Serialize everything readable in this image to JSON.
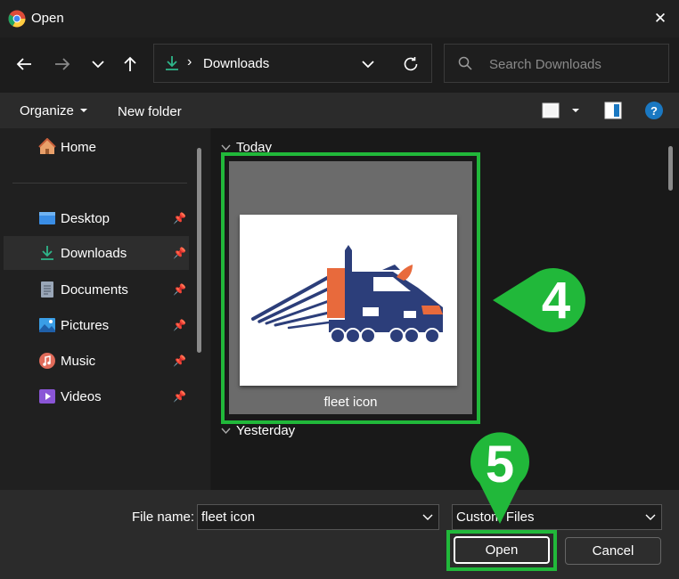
{
  "window": {
    "title": "Open",
    "close_label": "✕"
  },
  "nav": {
    "back_icon": "arrow-left-icon",
    "forward_icon": "arrow-right-icon",
    "recent_icon": "chevron-down-icon",
    "up_icon": "arrow-up-icon",
    "address": {
      "separator": "›",
      "location": "Downloads"
    },
    "search_placeholder": "Search Downloads"
  },
  "toolbar": {
    "organize_label": "Organize",
    "new_folder_label": "New folder",
    "help_label": "?"
  },
  "sidebar": {
    "home_label": "Home",
    "items": [
      {
        "label": "Desktop",
        "icon": "desktop-icon",
        "color": "#3a8ee6"
      },
      {
        "label": "Downloads",
        "icon": "download-icon",
        "color": "#2fb58a"
      },
      {
        "label": "Documents",
        "icon": "documents-icon",
        "color": "#9aa7b8"
      },
      {
        "label": "Pictures",
        "icon": "pictures-icon",
        "color": "#3a9ee6"
      },
      {
        "label": "Music",
        "icon": "music-icon",
        "color": "#e06b5a"
      },
      {
        "label": "Videos",
        "icon": "videos-icon",
        "color": "#8a55d6"
      }
    ]
  },
  "content": {
    "group_today": "Today",
    "group_yesterday": "Yesterday",
    "file": {
      "name": "fleet icon"
    }
  },
  "bottom": {
    "file_name_label": "File name:",
    "file_name_value": "fleet icon",
    "file_type_value": "Custom Files",
    "open_label": "Open",
    "cancel_label": "Cancel"
  },
  "annotations": {
    "step4": "4",
    "step5": "5",
    "highlight_color": "#21b83a"
  }
}
